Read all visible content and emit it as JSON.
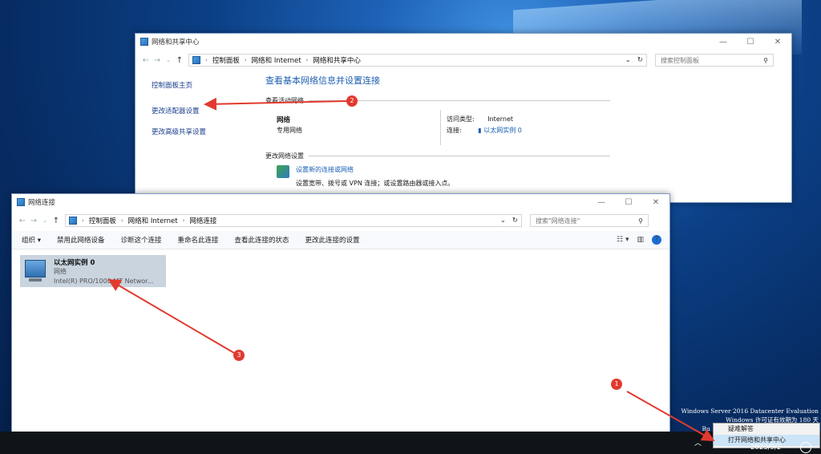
{
  "win1": {
    "title": "网络和共享中心",
    "crumb1": "控制面板",
    "crumb2": "网络和 Internet",
    "crumb3": "网络和共享中心",
    "search_placeholder": "搜索控制面板",
    "nav_home": "控制面板主页",
    "nav_adapter": "更改适配器设置",
    "nav_sharing": "更改高级共享设置",
    "heading": "查看基本网络信息并设置连接",
    "active_label": "查看活动网络",
    "net_name": "网络",
    "net_type": "专用网络",
    "access_label": "访问类型:",
    "access_value": "Internet",
    "conn_label": "连接:",
    "conn_value": "以太网实例 0",
    "change_label": "更改网络设置",
    "setup_link": "设置新的连接或网络",
    "setup_desc": "设置宽带、拨号或 VPN 连接；或设置路由器或接入点。"
  },
  "win2": {
    "title": "网络连接",
    "crumb1": "控制面板",
    "crumb2": "网络和 Internet",
    "crumb3": "网络连接",
    "search_placeholder": "搜索\"网络连接\"",
    "tb_org": "组织 ▾",
    "tb_disable": "禁用此网络设备",
    "tb_diag": "诊断这个连接",
    "tb_rename": "重命名此连接",
    "tb_status": "查看此连接的状态",
    "tb_change": "更改此连接的设置",
    "adapter_name": "以太网实例 0",
    "adapter_net": "网络",
    "adapter_desc": "Intel(R) PRO/1000 MT Networ..."
  },
  "watermark": {
    "line1": "Windows Server 2016 Datacenter Evaluation",
    "line2": "Windows 许可证有效期为 180 天",
    "line3": "Bu"
  },
  "traymenu": {
    "item1": "疑难解答",
    "item2": "打开网络和共享中心"
  },
  "clock": "2023/9/2",
  "badges": [
    "1",
    "2",
    "3"
  ],
  "colors": {
    "marker": "#e23a2f",
    "link": "#1a5fb4"
  }
}
